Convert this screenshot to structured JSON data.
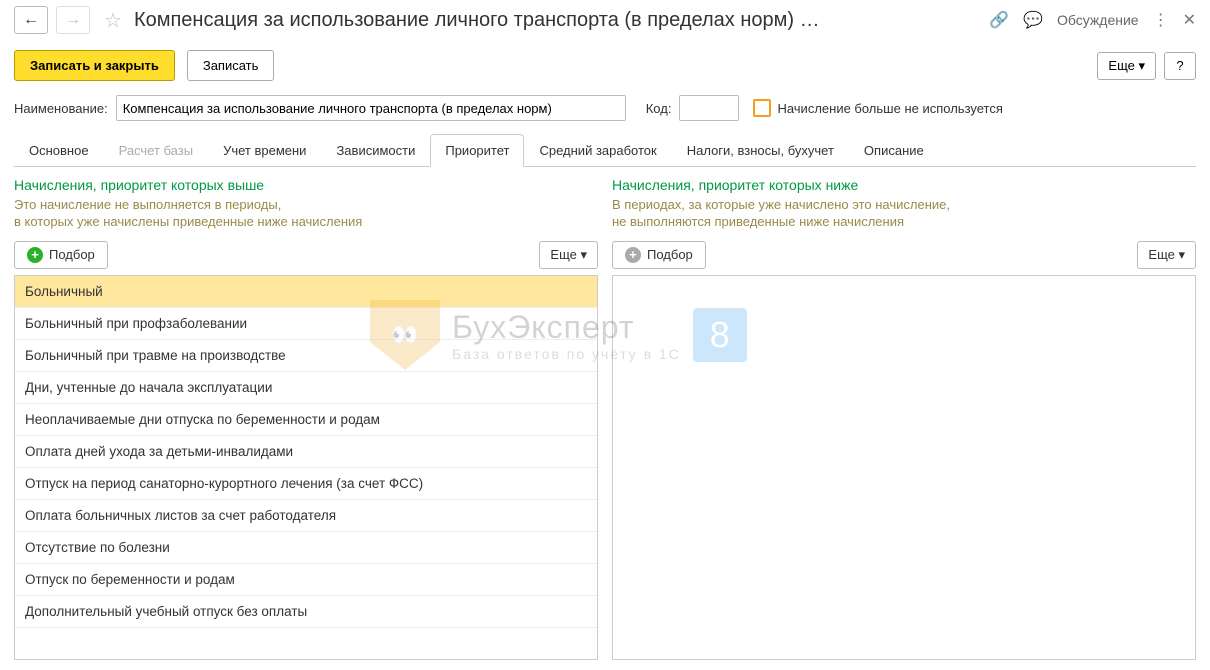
{
  "header": {
    "title": "Компенсация за использование личного транспорта (в пределах норм) …",
    "discuss": "Обсуждение"
  },
  "toolbar": {
    "save_close": "Записать и закрыть",
    "save": "Записать",
    "more": "Еще",
    "help": "?"
  },
  "form": {
    "name_label": "Наименование:",
    "name_value": "Компенсация за использование личного транспорта (в пределах норм)",
    "code_label": "Код:",
    "code_value": "",
    "disabled_label": "Начисление больше не используется"
  },
  "tabs": {
    "main": "Основное",
    "base": "Расчет базы",
    "time": "Учет времени",
    "deps": "Зависимости",
    "priority": "Приоритет",
    "avg": "Средний заработок",
    "tax": "Налоги, взносы, бухучет",
    "desc": "Описание"
  },
  "left_panel": {
    "title": "Начисления, приоритет которых выше",
    "desc": "Это начисление не выполняется в периоды,\nв которых уже начислены приведенные ниже начисления",
    "pick": "Подбор",
    "more": "Еще",
    "items": [
      "Больничный",
      "Больничный при профзаболевании",
      "Больничный при травме на производстве",
      "Дни, учтенные до начала эксплуатации",
      "Неоплачиваемые дни отпуска по беременности и родам",
      "Оплата дней ухода за детьми-инвалидами",
      "Отпуск на период санаторно-курортного лечения (за счет ФСС)",
      "Оплата больничных листов за счет работодателя",
      "Отсутствие по болезни",
      "Отпуск по беременности и родам",
      "Дополнительный учебный отпуск без оплаты"
    ]
  },
  "right_panel": {
    "title": "Начисления, приоритет которых ниже",
    "desc": "В периодах, за которые уже начислено это начисление,\nне выполняются приведенные ниже начисления",
    "pick": "Подбор",
    "more": "Еще"
  },
  "watermark": {
    "main": "БухЭксперт",
    "sub": "База ответов по учёту в 1С",
    "eight": "8"
  }
}
